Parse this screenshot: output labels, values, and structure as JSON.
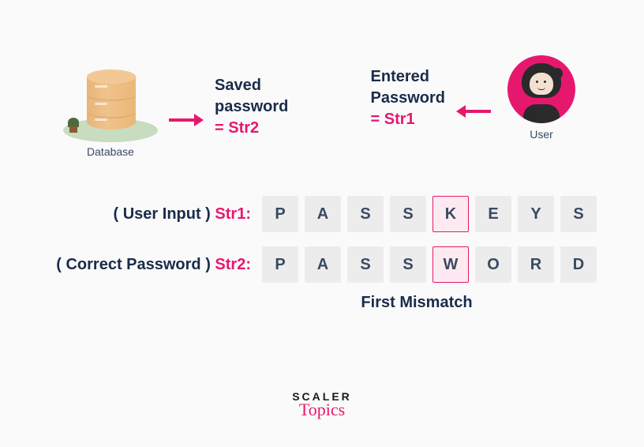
{
  "db": {
    "label": "Database",
    "text_line1": "Saved",
    "text_line2": "password",
    "text_eq": "= Str2"
  },
  "user": {
    "label": "User",
    "text_line1": "Entered",
    "text_line2": "Password",
    "text_eq": "= Str1"
  },
  "rows": {
    "input": {
      "label_paren": "( User Input )",
      "label_str": "Str1:",
      "cells": [
        "P",
        "A",
        "S",
        "S",
        "K",
        "E",
        "Y",
        "S"
      ],
      "mismatch_index": 4
    },
    "correct": {
      "label_paren": "( Correct Password )",
      "label_str": "Str2:",
      "cells": [
        "P",
        "A",
        "S",
        "S",
        "W",
        "O",
        "R",
        "D"
      ],
      "mismatch_index": 4
    }
  },
  "mismatch_label": "First Mismatch",
  "brand": {
    "line1": "SCALER",
    "line2": "Topics"
  }
}
